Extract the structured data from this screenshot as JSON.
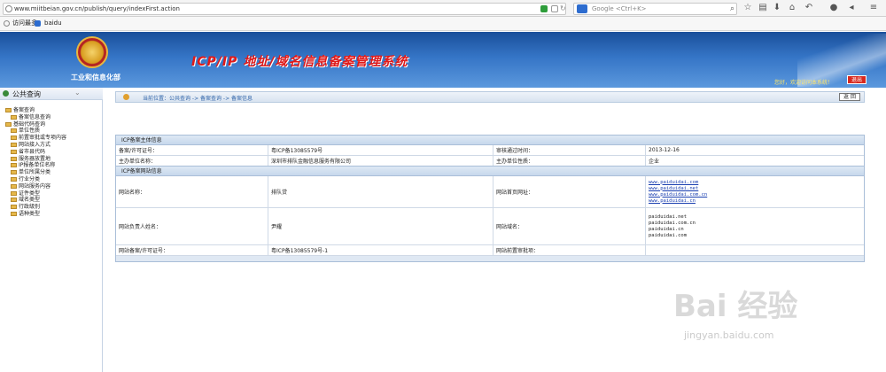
{
  "browser": {
    "url": "www.miitbeian.gov.cn/publish/query/indexFirst.action",
    "search_placeholder": "Google <Ctrl+K>",
    "bookmarks": [
      "访问最多",
      "baidu"
    ]
  },
  "header": {
    "ministry": "工业和信息化部",
    "system_title": "ICP/IP 地址/域名信息备案管理系统",
    "welcome": "您好，欢迎访问本系统！",
    "exit_label": "退出"
  },
  "sidebar": {
    "title": "公共查询",
    "items": [
      {
        "label": "备案查询",
        "level": 0
      },
      {
        "label": "备案信息查询",
        "level": 1
      },
      {
        "label": "基础代码查询",
        "level": 0
      },
      {
        "label": "单位性质",
        "level": 1
      },
      {
        "label": "前置审批或专项内容",
        "level": 1
      },
      {
        "label": "网站接入方式",
        "level": 1
      },
      {
        "label": "省市县代码",
        "level": 1
      },
      {
        "label": "服务器放置地",
        "level": 1
      },
      {
        "label": "IP报备单位名称",
        "level": 1
      },
      {
        "label": "单位所属分类",
        "level": 1
      },
      {
        "label": "行业分类",
        "level": 1
      },
      {
        "label": "网站服务内容",
        "level": 1
      },
      {
        "label": "证件类型",
        "level": 1
      },
      {
        "label": "域名类型",
        "level": 1
      },
      {
        "label": "行政级别",
        "level": 1
      },
      {
        "label": "语种类型",
        "level": 1
      }
    ]
  },
  "breadcrumb": {
    "text": "当前位置：公共查询  ->  备案查询  ->  备案信息",
    "back_label": "返 回"
  },
  "subject_panel": {
    "title": "ICP备案主体信息",
    "rows": [
      [
        "备案/许可证号：",
        "粤ICP备13085579号",
        "审核通过时间：",
        "2013-12-16"
      ],
      [
        "主办单位名称：",
        "深圳市排队金融信息服务有限公司",
        "主办单位性质：",
        "企业"
      ]
    ]
  },
  "site_panel": {
    "title": "ICP备案网站信息",
    "site_name_label": "网站名称：",
    "site_name": "排队贷",
    "homepage_label": "网站首页网址：",
    "homepages": [
      "www.paiduidai.com",
      "www.paiduidai.net",
      "www.paiduidai.com.cn",
      "www.paiduidai.cn"
    ],
    "owner_label": "网站负责人姓名：",
    "owner": "尹耀",
    "domain_label": "网站域名：",
    "domains": [
      "paiduidai.net",
      "paiduidai.com.cn",
      "paiduidai.cn",
      "paiduidai.com"
    ],
    "license_label": "网站备案/许可证号：",
    "license": "粤ICP备13085579号-1",
    "preapproval_label": "网站前置审批项：",
    "preapproval": ""
  },
  "watermark": {
    "brand": "Bai 经验",
    "url": "jingyan.baidu.com"
  }
}
